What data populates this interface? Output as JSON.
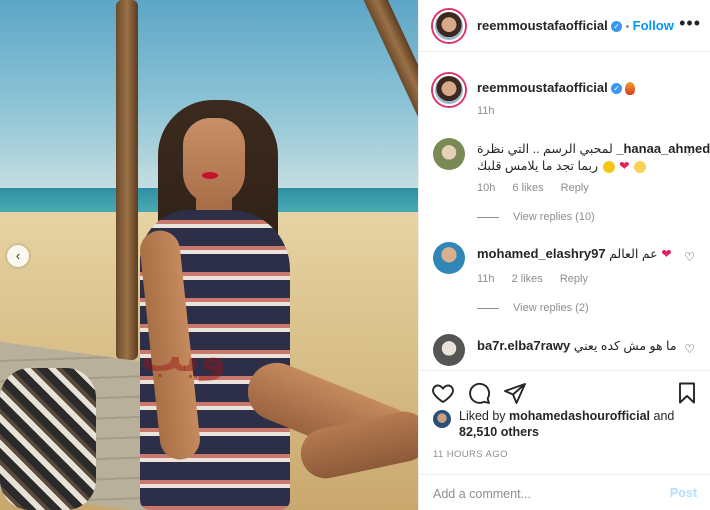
{
  "photo": {
    "watermark_text": "ويب",
    "prev_arrow": "‹"
  },
  "header": {
    "username": "reemmoustafaofficial",
    "follow_label": "Follow",
    "separator": "•",
    "more_icon": "more-dots-icon"
  },
  "caption": {
    "username": "reemmoustafaofficial",
    "time": "11h"
  },
  "comments": [
    {
      "username": "_hanaa_ahmed",
      "text_line1": "لمحبي الرسم .. التي نظرة",
      "text_line2": "ربما تجد ما يلامس قلبك",
      "time": "10h",
      "likes": "6 likes",
      "reply": "Reply",
      "view_replies": "View replies (10)"
    },
    {
      "username": "mohamed_elashry97",
      "text": "عم العالم",
      "time": "11h",
      "likes": "2 likes",
      "reply": "Reply",
      "view_replies": "View replies (2)"
    },
    {
      "username": "ba7r.elba7rawy",
      "text": "ما هو مش كده يعني"
    }
  ],
  "actions": {
    "like_icon": "heart-outline-icon",
    "comment_icon": "comment-icon",
    "share_icon": "paper-plane-icon",
    "save_icon": "bookmark-icon"
  },
  "likes": {
    "prefix": "Liked by ",
    "user": "mohamedashourofficial",
    "and": " and",
    "count": "82,510 others"
  },
  "timestamp": "11 HOURS AGO",
  "add_comment": {
    "placeholder": "Add a comment...",
    "post_label": "Post"
  },
  "colors": {
    "accent": "#0095f6",
    "verified": "#3897f0",
    "muted": "#8e8e8e",
    "text": "#262626"
  }
}
